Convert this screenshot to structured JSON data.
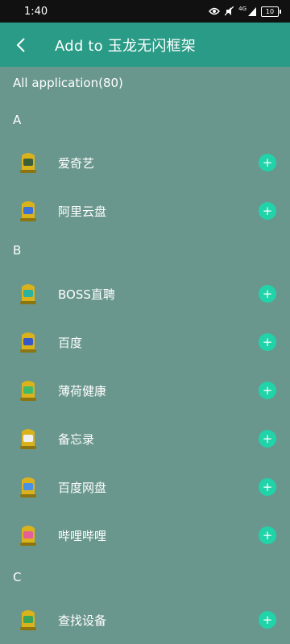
{
  "status_bar": {
    "time": "1:40",
    "network_label": "4G",
    "battery_level": "10"
  },
  "header": {
    "title": "Add to 玉龙无闪框架",
    "back_icon": "chevron-left-icon"
  },
  "list_title": "All application(80)",
  "sections": [
    {
      "letter": "A",
      "apps": [
        {
          "name": "爱奇艺",
          "icon": "app-iqiyi-icon",
          "accent": "#3a5f3a"
        },
        {
          "name": "阿里云盘",
          "icon": "app-aliyun-drive-icon",
          "accent": "#3b6fd9"
        }
      ]
    },
    {
      "letter": "B",
      "apps": [
        {
          "name": "BOSS直聘",
          "icon": "app-boss-icon",
          "accent": "#2bb3a0"
        },
        {
          "name": "百度",
          "icon": "app-baidu-icon",
          "accent": "#3657c9"
        },
        {
          "name": "薄荷健康",
          "icon": "app-mint-health-icon",
          "accent": "#3fb96a"
        },
        {
          "name": "备忘录",
          "icon": "app-memo-icon",
          "accent": "#f0f0f0"
        },
        {
          "name": "百度网盘",
          "icon": "app-baidu-netdisk-icon",
          "accent": "#4a8fe6"
        },
        {
          "name": "哔哩哔哩",
          "icon": "app-bilibili-icon",
          "accent": "#e45f9a"
        }
      ]
    },
    {
      "letter": "C",
      "apps": [
        {
          "name": "查找设备",
          "icon": "app-find-device-icon",
          "accent": "#3aa457"
        }
      ]
    }
  ],
  "add_button_symbol": "+",
  "colors": {
    "background": "#6a978d",
    "header": "#2a9b86",
    "add_button": "#20d3a8",
    "icon_body": "#d9b21c"
  }
}
